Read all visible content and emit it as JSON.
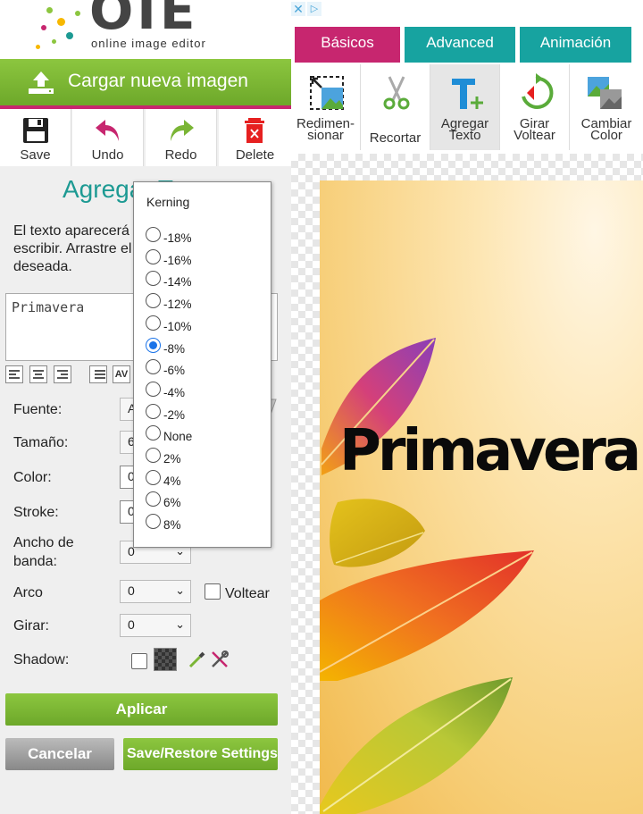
{
  "logo": {
    "letters": "OIE",
    "subtitle": "online image editor"
  },
  "upload_button": {
    "label": "Cargar nueva imagen"
  },
  "toolbar": {
    "save": "Save",
    "undo": "Undo",
    "redo": "Redo",
    "delete": "Delete"
  },
  "panel": {
    "title": "Agregar Texto",
    "description": "El texto aparecerá en la imagen al escribir. Arrastre el texto a la posición deseada.",
    "text_value": "Primavera",
    "fields": {
      "font_label": "Fuente:",
      "font_value": "Arial",
      "size_label": "Tamaño:",
      "size_value": "60",
      "color_label": "Color:",
      "color_value": "0",
      "stroke_label": "Stroke:",
      "stroke_value": "0",
      "band_label_1": "Ancho de",
      "band_label_2": "banda:",
      "band_value": "0",
      "arc_label": "Arco",
      "arc_value": "0",
      "flip_label": "Voltear",
      "rotate_label": "Girar:",
      "rotate_value": "0",
      "shadow_label": "Shadow:"
    },
    "apply": "Aplicar",
    "cancel": "Cancelar",
    "save_restore": "Save/Restore Settings"
  },
  "kerning": {
    "title": "Kerning",
    "selected": "-8%",
    "options": [
      "-18%",
      "-16%",
      "-14%",
      "-12%",
      "-10%",
      "-8%",
      "-6%",
      "-4%",
      "-2%",
      "None",
      "2%",
      "4%",
      "6%",
      "8%"
    ]
  },
  "tabs": {
    "basicos": "Básicos",
    "advanced": "Advanced",
    "animacion": "Animación"
  },
  "tools": {
    "resize_1": "Redimen-",
    "resize_2": "sionar",
    "crop": "Recortar",
    "add_text_1": "Agregar",
    "add_text_2": "Texto",
    "rotate_1": "Girar",
    "rotate_2": "Voltear",
    "color_1": "Cambiar",
    "color_2": "Color"
  },
  "image": {
    "overlay_text": "Primavera"
  },
  "colors": {
    "green": "#7ab535",
    "magenta": "#c7266f",
    "teal": "#17a3a0"
  }
}
